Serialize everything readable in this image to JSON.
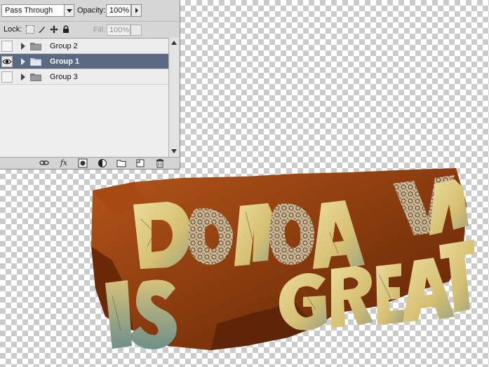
{
  "layers_panel": {
    "blend_mode": "Pass Through",
    "opacity_label": "Opacity:",
    "opacity_value": "100%",
    "lock_label": "Lock:",
    "fill_label": "Fill:",
    "fill_value": "100%",
    "layers": [
      {
        "name": "Group 2",
        "visible": false,
        "selected": false
      },
      {
        "name": "Group 1",
        "visible": true,
        "selected": true
      },
      {
        "name": "Group 3",
        "visible": false,
        "selected": false
      }
    ],
    "bottom_icons": [
      "link-icon",
      "fx-icon",
      "mask-icon",
      "adjustment-icon",
      "new-group-icon",
      "new-layer-icon",
      "trash-icon"
    ],
    "fx_label": "fx"
  },
  "artwork": {
    "colors": {
      "rust": "#8a3b0e",
      "dark_rust": "#5a2307",
      "face": "#d9c47a",
      "teal": "#6d8f8a"
    }
  }
}
